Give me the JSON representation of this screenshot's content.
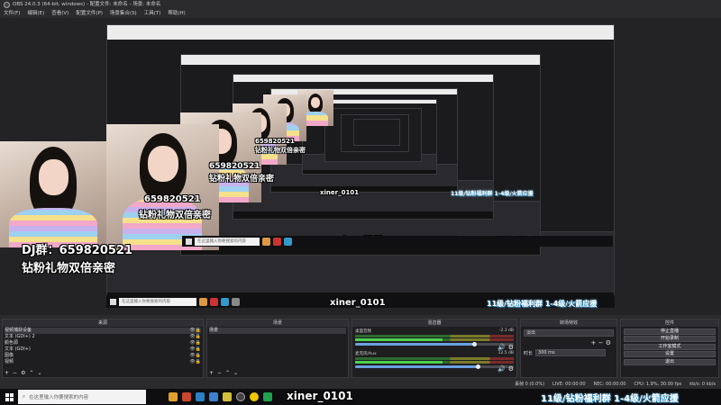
{
  "window": {
    "title": "OBS 24.0.3 (64-bit, windows) - 配置文件: 未命名 - 场景: 未命名"
  },
  "menu": [
    "文件(F)",
    "编辑(E)",
    "查看(V)",
    "配置文件(P)",
    "场景集合(S)",
    "工具(T)",
    "帮助(H)"
  ],
  "overlay": {
    "qq_group": "DJ群：659820521",
    "qq_number": "659820521",
    "gift_line": "钻粉礼物双倍亲密",
    "tiktok_id": "xiner_0101",
    "banner": "11级/钻粉福利群 1-4级/火箭应援"
  },
  "sources_panel": {
    "title": "来源",
    "items": [
      "视频捕获设备",
      "文本 (GDI+) 2",
      "颜色源",
      "文本 (GDI+)",
      "图像",
      "视频"
    ]
  },
  "scenes_panel": {
    "title": "场景",
    "items": [
      "场景"
    ]
  },
  "mixer_panel": {
    "title": "混音器",
    "tracks": [
      {
        "name": "桌面音频",
        "db": "-2.3 dB"
      },
      {
        "name": "麦克风/Aux",
        "db": "12.5 dB"
      }
    ]
  },
  "transitions_panel": {
    "title": "转场特效",
    "effect": "淡出",
    "duration_label": "时长",
    "duration": "300 ms"
  },
  "controls_panel": {
    "title": "控件",
    "buttons": [
      "停止直播",
      "开始录制",
      "工作室模式",
      "设置",
      "退出"
    ]
  },
  "status": {
    "dropped": "丢帧 0 (0.0%)",
    "live": "LIVE: 00:00:00",
    "rec": "REC: 00:00:00",
    "cpu": "CPU: 1.9%, 30.00 fps",
    "kbps": "kb/s: 0 kb/s"
  },
  "taskbar": {
    "search_placeholder": "在这里输入你要搜索的内容"
  }
}
